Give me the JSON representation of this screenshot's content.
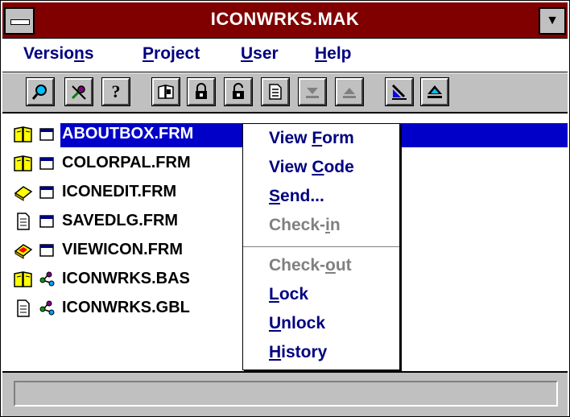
{
  "window": {
    "title": "ICONWRKS.MAK",
    "minimize_glyph": "▼"
  },
  "menubar": {
    "items": [
      {
        "pre": "Versio",
        "accel": "n",
        "post": "s"
      },
      {
        "pre": "",
        "accel": "P",
        "post": "roject"
      },
      {
        "pre": "",
        "accel": "U",
        "post": "ser"
      },
      {
        "pre": "",
        "accel": "H",
        "post": "elp"
      }
    ]
  },
  "toolbar": {
    "help_glyph": "?"
  },
  "files": [
    {
      "name": "ABOUTBOX.FRM",
      "status_icon": "open-book-icon",
      "type_icon": "form-icon",
      "selected": true
    },
    {
      "name": "COLORPAL.FRM",
      "status_icon": "open-book-icon",
      "type_icon": "form-icon",
      "selected": false
    },
    {
      "name": "ICONEDIT.FRM",
      "status_icon": "closed-book-icon",
      "type_icon": "form-icon",
      "selected": false
    },
    {
      "name": "SAVEDLG.FRM",
      "status_icon": "document-icon",
      "type_icon": "form-icon",
      "selected": false
    },
    {
      "name": "VIEWICON.FRM",
      "status_icon": "checked-out-book-icon",
      "type_icon": "form-icon",
      "selected": false
    },
    {
      "name": "ICONWRKS.BAS",
      "status_icon": "open-book-icon",
      "type_icon": "module-icon",
      "selected": false
    },
    {
      "name": "ICONWRKS.GBL",
      "status_icon": "document-icon",
      "type_icon": "module-icon",
      "selected": false
    }
  ],
  "context_menu": {
    "view_form": {
      "pre": "View ",
      "accel": "F",
      "post": "orm"
    },
    "view_code": {
      "pre": "View ",
      "accel": "C",
      "post": "ode"
    },
    "send": {
      "pre": "",
      "accel": "S",
      "post": "end..."
    },
    "check_in": {
      "pre": "Check-",
      "accel": "i",
      "post": "n"
    },
    "check_out": {
      "pre": "Check-",
      "accel": "o",
      "post": "ut"
    },
    "lock": {
      "pre": "",
      "accel": "L",
      "post": "ock"
    },
    "unlock": {
      "pre": "",
      "accel": "U",
      "post": "nlock"
    },
    "history": {
      "pre": "",
      "accel": "H",
      "post": "istory"
    }
  },
  "colors": {
    "title_bar": "#800000",
    "selection": "#0000c8",
    "menu_text": "#000080",
    "disabled_text": "#808080",
    "chrome": "#c0c0c0"
  }
}
